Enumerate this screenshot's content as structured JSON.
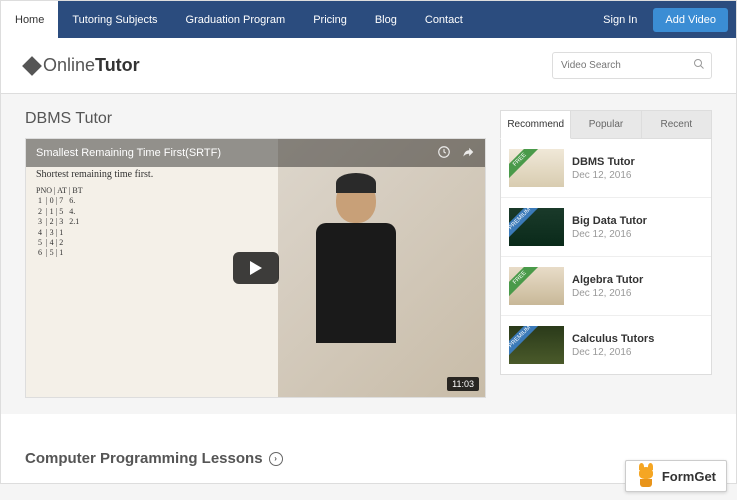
{
  "nav": {
    "items": [
      {
        "label": "Home",
        "active": true
      },
      {
        "label": "Tutoring Subjects",
        "active": false
      },
      {
        "label": "Graduation Program",
        "active": false
      },
      {
        "label": "Pricing",
        "active": false
      },
      {
        "label": "Blog",
        "active": false
      },
      {
        "label": "Contact",
        "active": false
      }
    ],
    "signin": "Sign In",
    "add_video": "Add Video"
  },
  "logo": {
    "prefix": "Online",
    "suffix": "Tutor"
  },
  "search": {
    "placeholder": "Video Search"
  },
  "page": {
    "title": "DBMS Tutor"
  },
  "video": {
    "title": "Smallest Remaining Time First(SRTF)",
    "duration": "11:03",
    "whiteboard_heading": "Shortest remaining time first."
  },
  "sidebar": {
    "tabs": [
      {
        "label": "Recommend",
        "active": true
      },
      {
        "label": "Popular",
        "active": false
      },
      {
        "label": "Recent",
        "active": false
      }
    ],
    "items": [
      {
        "title": "DBMS Tutor",
        "date": "Dec 12, 2016",
        "ribbon": "FREE",
        "ribbon_type": "free",
        "thumb": "t1"
      },
      {
        "title": "Big Data Tutor",
        "date": "Dec 12, 2016",
        "ribbon": "PREMIUM",
        "ribbon_type": "premium",
        "thumb": "t2"
      },
      {
        "title": "Algebra Tutor",
        "date": "Dec 12, 2016",
        "ribbon": "FREE",
        "ribbon_type": "free",
        "thumb": "t3"
      },
      {
        "title": "Calculus Tutors",
        "date": "Dec 12, 2016",
        "ribbon": "PREMIUM",
        "ribbon_type": "premium",
        "thumb": "t4"
      }
    ]
  },
  "section": {
    "title": "Computer Programming Lessons"
  },
  "badge": {
    "text": "FormGet"
  }
}
